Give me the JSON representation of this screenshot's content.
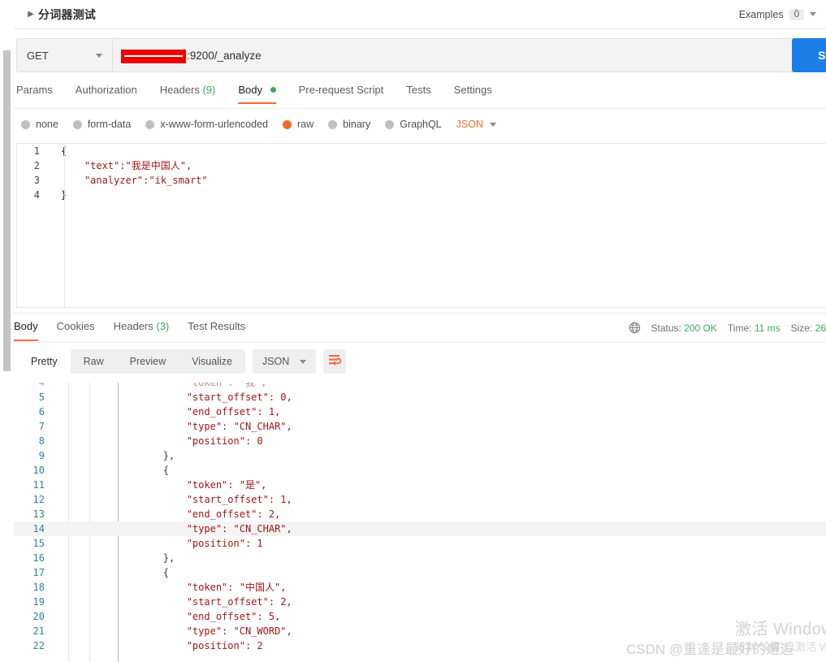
{
  "titlebar": {
    "collapse_icon": "triangle-right-icon",
    "title": "分词器测试",
    "examples_label": "Examples",
    "examples_count": "0"
  },
  "request": {
    "method": "GET",
    "url_redacted": true,
    "url_text": ":9200/_analyze",
    "send_label": "Sen",
    "tabs": [
      {
        "label": "Params",
        "count": "",
        "active": false,
        "dot": false
      },
      {
        "label": "Authorization",
        "count": "",
        "active": false,
        "dot": false
      },
      {
        "label": "Headers",
        "count": "(9)",
        "active": false,
        "dot": false
      },
      {
        "label": "Body",
        "count": "",
        "active": true,
        "dot": true
      },
      {
        "label": "Pre-request Script",
        "count": "",
        "active": false,
        "dot": false
      },
      {
        "label": "Tests",
        "count": "",
        "active": false,
        "dot": false
      },
      {
        "label": "Settings",
        "count": "",
        "active": false,
        "dot": false
      }
    ],
    "body_types": [
      {
        "label": "none",
        "selected": false
      },
      {
        "label": "form-data",
        "selected": false
      },
      {
        "label": "x-www-form-urlencoded",
        "selected": false
      },
      {
        "label": "raw",
        "selected": true
      },
      {
        "label": "binary",
        "selected": false
      },
      {
        "label": "GraphQL",
        "selected": false
      }
    ],
    "format_selected": "JSON",
    "body_lines": [
      {
        "n": "1",
        "text": "{"
      },
      {
        "n": "2",
        "text": "    \"text\":\"我是中国人\","
      },
      {
        "n": "3",
        "text": "    \"analyzer\":\"ik_smart\""
      },
      {
        "n": "4",
        "text": "}"
      }
    ]
  },
  "response": {
    "tabs": [
      {
        "label": "Body",
        "count": "",
        "active": true
      },
      {
        "label": "Cookies",
        "count": "",
        "active": false
      },
      {
        "label": "Headers",
        "count": "(3)",
        "active": false
      },
      {
        "label": "Test Results",
        "count": "",
        "active": false
      }
    ],
    "status_label": "Status:",
    "status_value": "200 OK",
    "time_label": "Time:",
    "time_value": "11 ms",
    "size_label": "Size:",
    "size_value": "26",
    "view_modes": [
      {
        "label": "Pretty",
        "active": true
      },
      {
        "label": "Raw",
        "active": false
      },
      {
        "label": "Preview",
        "active": false
      },
      {
        "label": "Visualize",
        "active": false
      }
    ],
    "format_selected": "JSON",
    "wrap_icon": "word-wrap-icon",
    "globe_icon": "globe-icon",
    "body_lines": [
      {
        "n": "4",
        "text": "            \"token\": \"我\",",
        "highlight": false,
        "clipped": true
      },
      {
        "n": "5",
        "text": "            \"start_offset\": 0,",
        "highlight": false
      },
      {
        "n": "6",
        "text": "            \"end_offset\": 1,",
        "highlight": false
      },
      {
        "n": "7",
        "text": "            \"type\": \"CN_CHAR\",",
        "highlight": false
      },
      {
        "n": "8",
        "text": "            \"position\": 0",
        "highlight": false
      },
      {
        "n": "9",
        "text": "        },",
        "highlight": false
      },
      {
        "n": "10",
        "text": "        {",
        "highlight": false
      },
      {
        "n": "11",
        "text": "            \"token\": \"是\",",
        "highlight": false
      },
      {
        "n": "12",
        "text": "            \"start_offset\": 1,",
        "highlight": false
      },
      {
        "n": "13",
        "text": "            \"end_offset\": 2,",
        "highlight": false
      },
      {
        "n": "14",
        "text": "            \"type\": \"CN_CHAR\",",
        "highlight": true
      },
      {
        "n": "15",
        "text": "            \"position\": 1",
        "highlight": false
      },
      {
        "n": "16",
        "text": "        },",
        "highlight": false
      },
      {
        "n": "17",
        "text": "        {",
        "highlight": false
      },
      {
        "n": "18",
        "text": "            \"token\": \"中国人\",",
        "highlight": false
      },
      {
        "n": "19",
        "text": "            \"start_offset\": 2,",
        "highlight": false
      },
      {
        "n": "20",
        "text": "            \"end_offset\": 5,",
        "highlight": false
      },
      {
        "n": "21",
        "text": "            \"type\": \"CN_WORD\",",
        "highlight": false
      },
      {
        "n": "22",
        "text": "            \"position\": 2",
        "highlight": false
      }
    ]
  },
  "watermarks": {
    "windows_line1": "激活 Windows",
    "windows_line2": "转到\"设置\"以激活 Windows。",
    "csdn": "CSDN @重逢是最好的邂逅"
  },
  "colors": {
    "accent_orange": "#f26b3a",
    "send_blue": "#1a7fe8",
    "status_green": "#3aaa5e",
    "redaction_red": "#ee0000"
  }
}
